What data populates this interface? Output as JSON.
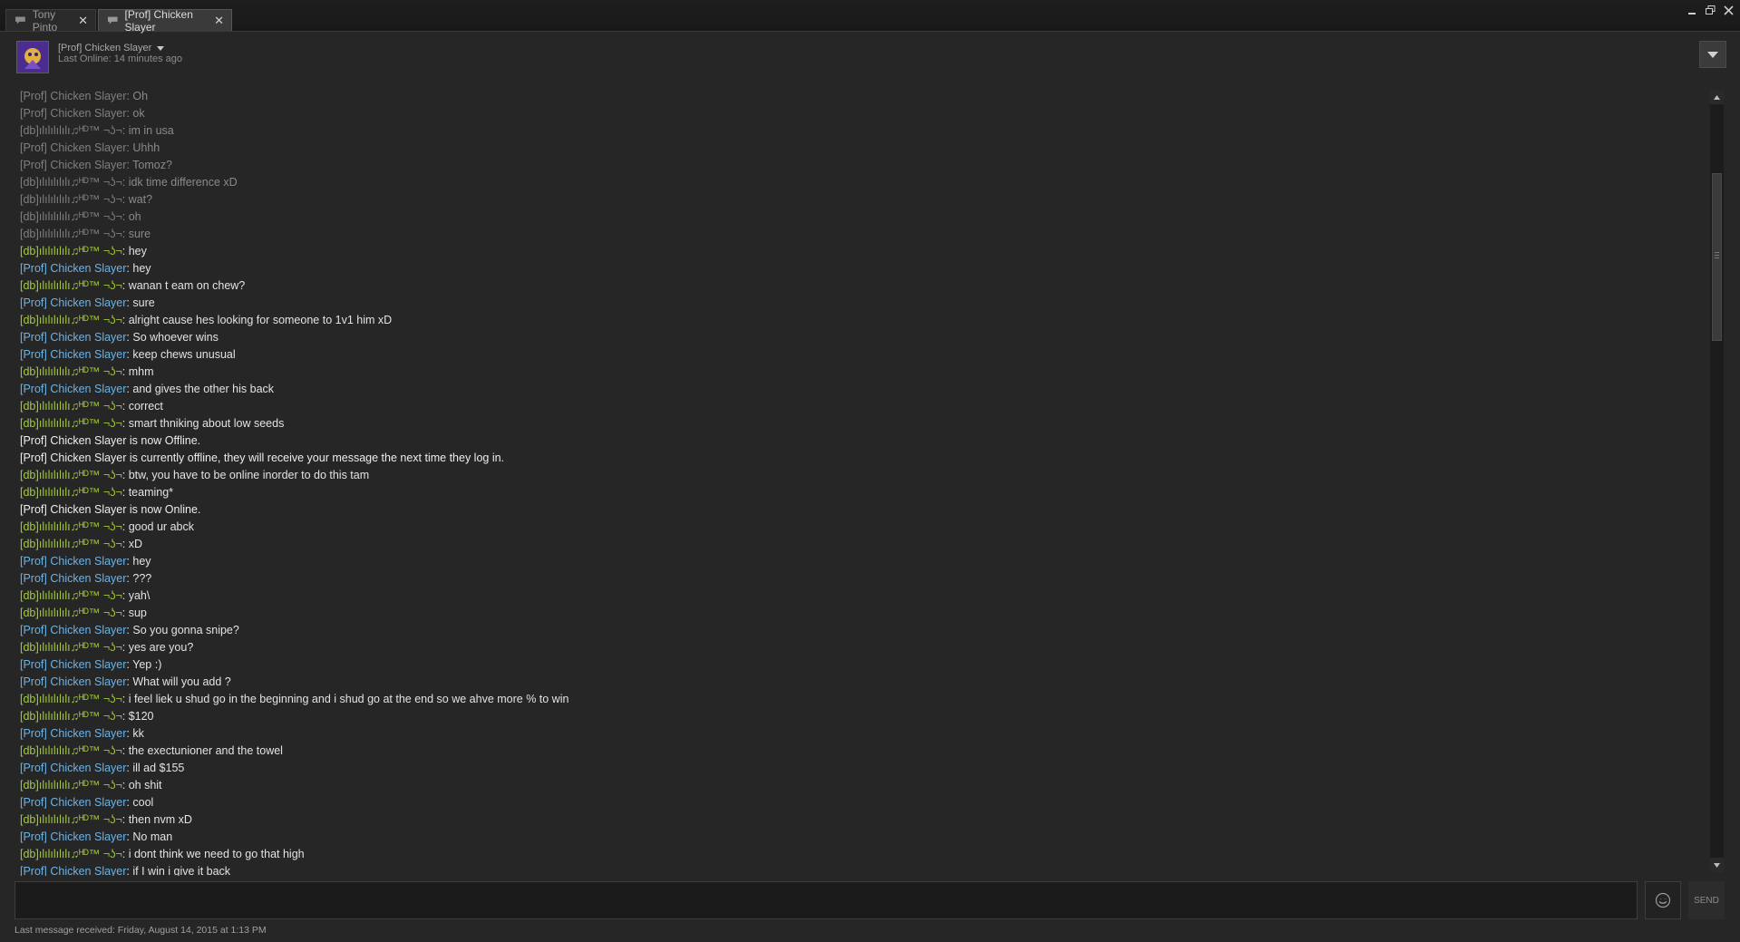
{
  "tabs": [
    {
      "label": "Tony Pinto",
      "active": false
    },
    {
      "label": "[Prof] Chicken Slayer",
      "active": true
    }
  ],
  "header": {
    "friend_name": "[Prof] Chicken Slayer",
    "status": "Last Online: 14 minutes ago"
  },
  "speakers": {
    "prof": "[Prof] Chicken Slayer",
    "db": "[db]ılılılılılı♫ᴴᴰ™ ¬ʖ¬"
  },
  "colors": {
    "friend": "#6cb3e6",
    "self": "#a3c93a",
    "history": "#7f7f7f",
    "system": "#ededed"
  },
  "messages": [
    {
      "speaker": "[Prof] Chicken Slayer",
      "kind": "old",
      "text": "Oh"
    },
    {
      "speaker": "[Prof] Chicken Slayer",
      "kind": "old",
      "text": "ok"
    },
    {
      "speaker": "[db]ılılılılılı♫ᴴᴰ™ ¬ʖ¬",
      "kind": "old",
      "text": "im in usa"
    },
    {
      "speaker": "[Prof] Chicken Slayer",
      "kind": "old",
      "text": "Uhhh"
    },
    {
      "speaker": "[Prof] Chicken Slayer",
      "kind": "old",
      "text": "Tomoz?"
    },
    {
      "speaker": "[db]ılılılılılı♫ᴴᴰ™ ¬ʖ¬",
      "kind": "old",
      "text": "idk time difference xD"
    },
    {
      "speaker": "[db]ılılılılılı♫ᴴᴰ™ ¬ʖ¬",
      "kind": "old",
      "text": "wat?"
    },
    {
      "speaker": "[db]ılılılılılı♫ᴴᴰ™ ¬ʖ¬",
      "kind": "old",
      "text": "oh"
    },
    {
      "speaker": "[db]ılılılılılı♫ᴴᴰ™ ¬ʖ¬",
      "kind": "old",
      "text": "sure"
    },
    {
      "speaker": "[db]ılılılılılı♫ᴴᴰ™ ¬ʖ¬",
      "kind": "green",
      "text": "hey"
    },
    {
      "speaker": "[Prof] Chicken Slayer",
      "kind": "blue",
      "text": "hey"
    },
    {
      "speaker": "[db]ılılılılılı♫ᴴᴰ™ ¬ʖ¬",
      "kind": "green",
      "text": "wanan t eam on chew?"
    },
    {
      "speaker": "[Prof] Chicken Slayer",
      "kind": "blue",
      "text": "sure"
    },
    {
      "speaker": "[db]ılılılılılı♫ᴴᴰ™ ¬ʖ¬",
      "kind": "green",
      "text": "alright cause hes looking for someone to 1v1 him xD"
    },
    {
      "speaker": "[Prof] Chicken Slayer",
      "kind": "blue",
      "text": "So whoever wins"
    },
    {
      "speaker": "[Prof] Chicken Slayer",
      "kind": "blue",
      "text": "keep chews unusual"
    },
    {
      "speaker": "[db]ılılılılılı♫ᴴᴰ™ ¬ʖ¬",
      "kind": "green",
      "text": "mhm"
    },
    {
      "speaker": "[Prof] Chicken Slayer",
      "kind": "blue",
      "text": "and gives the other his back"
    },
    {
      "speaker": "[db]ılılılılılı♫ᴴᴰ™ ¬ʖ¬",
      "kind": "green",
      "text": "correct"
    },
    {
      "speaker": "[db]ılılılılılı♫ᴴᴰ™ ¬ʖ¬",
      "kind": "green",
      "text": "smart thniking about low seeds"
    },
    {
      "speaker": "",
      "kind": "system",
      "text": "[Prof] Chicken Slayer is now Offline."
    },
    {
      "speaker": "",
      "kind": "system",
      "text": "[Prof] Chicken Slayer is currently offline, they will receive your message the next time they log in."
    },
    {
      "speaker": "[db]ılılılılılı♫ᴴᴰ™ ¬ʖ¬",
      "kind": "green",
      "text": "btw, you have to be online inorder to do this tam"
    },
    {
      "speaker": "[db]ılılılılılı♫ᴴᴰ™ ¬ʖ¬",
      "kind": "green",
      "text": "teaming*"
    },
    {
      "speaker": "",
      "kind": "system",
      "text": "[Prof] Chicken Slayer is now Online."
    },
    {
      "speaker": "[db]ılılılılılı♫ᴴᴰ™ ¬ʖ¬",
      "kind": "green",
      "text": "good ur abck"
    },
    {
      "speaker": "[db]ılılılılılı♫ᴴᴰ™ ¬ʖ¬",
      "kind": "green",
      "text": "xD"
    },
    {
      "speaker": "[Prof] Chicken Slayer",
      "kind": "blue",
      "text": "hey"
    },
    {
      "speaker": "[Prof] Chicken Slayer",
      "kind": "blue",
      "text": "???"
    },
    {
      "speaker": "[db]ılılılılılı♫ᴴᴰ™ ¬ʖ¬",
      "kind": "green",
      "text": "yah\\"
    },
    {
      "speaker": "[db]ılılılılılı♫ᴴᴰ™ ¬ʖ¬",
      "kind": "green",
      "text": "sup"
    },
    {
      "speaker": "[Prof] Chicken Slayer",
      "kind": "blue",
      "text": "So you gonna snipe?"
    },
    {
      "speaker": "[db]ılılılılılı♫ᴴᴰ™ ¬ʖ¬",
      "kind": "green",
      "text": "yes are you?"
    },
    {
      "speaker": "[Prof] Chicken Slayer",
      "kind": "blue",
      "text": "Yep :)"
    },
    {
      "speaker": "[Prof] Chicken Slayer",
      "kind": "blue",
      "text": "What will you add ?"
    },
    {
      "speaker": "[db]ılılılılılı♫ᴴᴰ™ ¬ʖ¬",
      "kind": "green",
      "text": "i feel liek u shud go in the beginning and i shud go at the end so we ahve more % to win"
    },
    {
      "speaker": "[db]ılılılılılı♫ᴴᴰ™ ¬ʖ¬",
      "kind": "green",
      "text": "$120"
    },
    {
      "speaker": "[Prof] Chicken Slayer",
      "kind": "blue",
      "text": "kk"
    },
    {
      "speaker": "[db]ılılılılılı♫ᴴᴰ™ ¬ʖ¬",
      "kind": "green",
      "text": "the exectunioner and the towel"
    },
    {
      "speaker": "[Prof] Chicken Slayer",
      "kind": "blue",
      "text": "ill ad $155"
    },
    {
      "speaker": "[db]ılılılılılı♫ᴴᴰ™ ¬ʖ¬",
      "kind": "green",
      "text": "oh shit"
    },
    {
      "speaker": "[Prof] Chicken Slayer",
      "kind": "blue",
      "text": "cool"
    },
    {
      "speaker": "[db]ılılılılılı♫ᴴᴰ™ ¬ʖ¬",
      "kind": "green",
      "text": "then nvm xD"
    },
    {
      "speaker": "[Prof] Chicken Slayer",
      "kind": "blue",
      "text": "No man"
    },
    {
      "speaker": "[db]ılılılılılı♫ᴴᴰ™ ¬ʖ¬",
      "kind": "green",
      "text": "i dont think we need to go that high"
    },
    {
      "speaker": "[Prof] Chicken Slayer",
      "kind": "blue",
      "text": "if I win i give it back"
    }
  ],
  "entry": {
    "value": "",
    "send_label": "SEND"
  },
  "footer": {
    "last_received": "Last message received: Friday, August 14, 2015 at 1:13 PM"
  },
  "icons": {
    "tab": "chat-bubble-icon",
    "tab_close": "close-icon",
    "minimize": "minimize-icon",
    "restore": "restore-icon",
    "close": "close-window-icon",
    "dropdown": "chevron-down-icon",
    "options": "options-dropdown-icon",
    "emoticon": "emoticon-icon"
  }
}
